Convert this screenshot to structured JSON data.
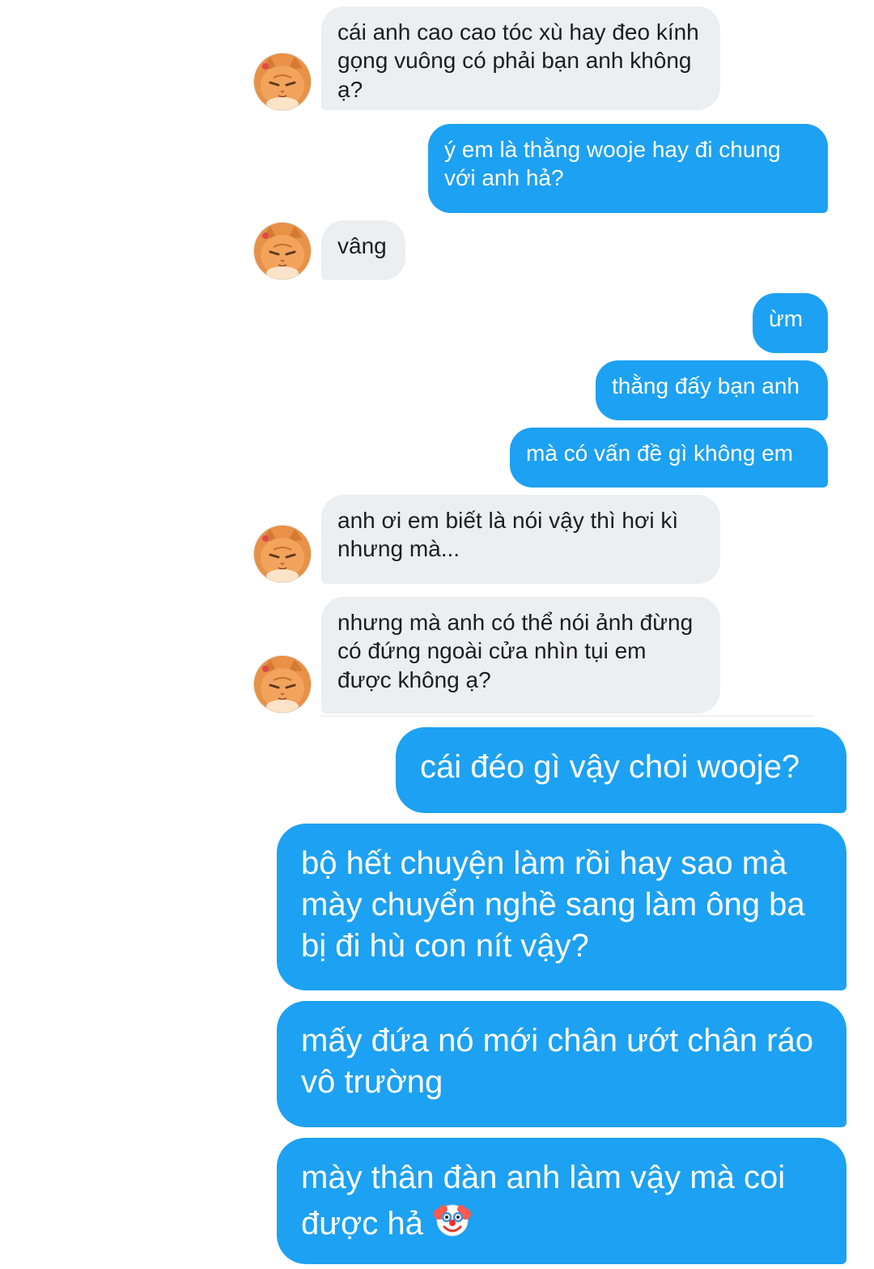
{
  "conversation": {
    "messages": [
      {
        "from": "contact",
        "text": "cái anh cao cao tóc xù hay đeo kính gọng vuông có phải bạn anh không ạ?"
      },
      {
        "from": "me",
        "text": "ý em là thằng wooje hay đi chung với anh hả?"
      },
      {
        "from": "contact",
        "text": "vâng"
      },
      {
        "from": "me",
        "text": "ừm"
      },
      {
        "from": "me",
        "text": "thằng đấy bạn anh"
      },
      {
        "from": "me",
        "text": "mà có vấn đề gì không em"
      },
      {
        "from": "contact",
        "text": "anh ơi em biết là nói vậy thì hơi kì nhưng mà..."
      },
      {
        "from": "contact",
        "text": "nhưng mà anh có thể nói ảnh đừng có đứng ngoài cửa nhìn tụi em được không ạ?"
      },
      {
        "from": "me",
        "text": "cái đéo gì vậy choi wooje?"
      },
      {
        "from": "me",
        "text": "bộ hết chuyện làm rồi hay sao mà mày chuyển nghề sang làm ông ba bị đi hù con nít vậy?"
      },
      {
        "from": "me",
        "text": "mấy đứa nó mới chân ướt chân ráo vô trường"
      },
      {
        "from": "me",
        "text": "mày thân đàn anh làm vậy mà coi được hả",
        "emoji": "clown-face"
      }
    ]
  },
  "colors": {
    "sent_bubble": "#1da1f2",
    "received_bubble": "#eceff1",
    "sent_text": "#ffffff",
    "received_text": "#1d1d1d"
  },
  "contact": {
    "avatar_icon": "orange-cat-avatar"
  }
}
